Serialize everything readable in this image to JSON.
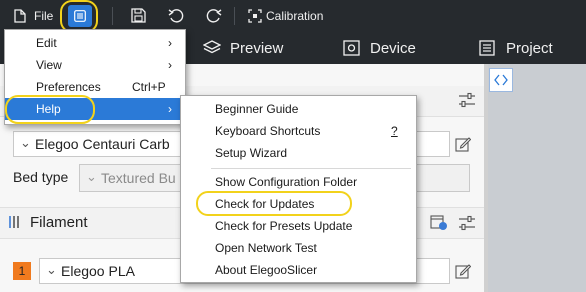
{
  "toolbar": {
    "file_label": "File",
    "calibration_label": "Calibration"
  },
  "tabs": {
    "preview": "Preview",
    "device": "Device",
    "project": "Project"
  },
  "printer": {
    "selected": "Elegoo Centauri Carb",
    "bed_type_label": "Bed type",
    "bed_type_value": "Textured Bu"
  },
  "filament": {
    "section_label": "Filament",
    "slot_number": "1",
    "selected": "Elegoo PLA"
  },
  "main_menu": {
    "items": [
      {
        "label": "Edit",
        "shortcut": "",
        "submenu": true
      },
      {
        "label": "View",
        "shortcut": "",
        "submenu": true
      },
      {
        "label": "Preferences",
        "shortcut": "Ctrl+P",
        "submenu": false
      },
      {
        "label": "Help",
        "shortcut": "",
        "submenu": true
      }
    ]
  },
  "help_menu": {
    "items": [
      {
        "label": "Beginner Guide",
        "shortcut": ""
      },
      {
        "label": "Keyboard Shortcuts",
        "shortcut": "?"
      },
      {
        "label": "Setup Wizard",
        "shortcut": ""
      },
      {
        "label": "Show Configuration Folder",
        "shortcut": ""
      },
      {
        "label": "Check for Updates",
        "shortcut": ""
      },
      {
        "label": "Check for Presets Update",
        "shortcut": ""
      },
      {
        "label": "Open Network Test",
        "shortcut": ""
      },
      {
        "label": "About ElegooSlicer",
        "shortcut": ""
      }
    ]
  },
  "colors": {
    "toolbar_bg": "#262a2e",
    "accent_blue": "#2b7ad7",
    "highlight_yellow": "#f2d21b",
    "filament_slot": "#f07a1e"
  }
}
